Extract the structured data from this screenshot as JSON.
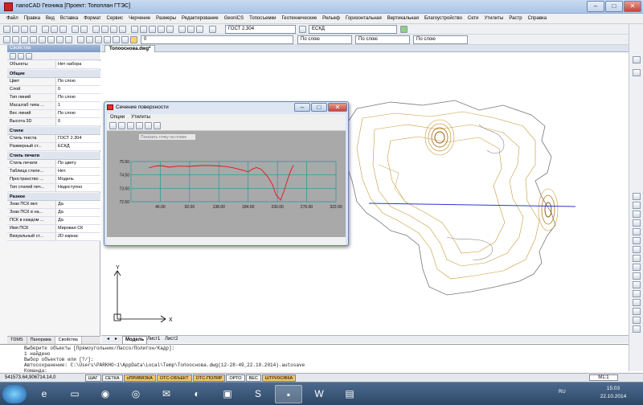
{
  "app": {
    "title": "nanoCAD Геоника [Проект: Топоплан ГТЭС]"
  },
  "window_controls": {
    "minimize": "–",
    "maximize": "□",
    "close": "✕"
  },
  "menu": [
    "Файл",
    "Правка",
    "Вид",
    "Вставка",
    "Формат",
    "Сервис",
    "Черчение",
    "Размеры",
    "Редактирование",
    "GeoniCS",
    "Топосъемки",
    "Геотехнические",
    "Рельеф",
    "Горизонтальная",
    "Вертикальная",
    "Благоустройство",
    "Сети",
    "Утилиты",
    "Растр",
    "Справка"
  ],
  "toolbar": {
    "text_style": "ГОСТ 2.304",
    "dim_style": "ЕСКД",
    "layer_value": "0",
    "linetype1": "По слою",
    "linetype2": "По слою",
    "lineweight": "По слою"
  },
  "properties": {
    "title": "Свойства",
    "objects_key": "Объекты",
    "objects_value": "Нет набора",
    "sections": {
      "general": "Общие",
      "styles": "Стили",
      "print_style": "Стиль печати",
      "misc": "Разное"
    },
    "general_rows": [
      {
        "k": "Цвет",
        "v": "По слою"
      },
      {
        "k": "Слой",
        "v": "0"
      },
      {
        "k": "Тип линий",
        "v": "По слою"
      },
      {
        "k": "Масштаб типа ...",
        "v": "1"
      },
      {
        "k": "Вес линий",
        "v": "По слою"
      },
      {
        "k": "Высота 3D",
        "v": "0"
      }
    ],
    "styles_rows": [
      {
        "k": "Стиль текста",
        "v": "ГОСТ 2.304"
      },
      {
        "k": "Размерный ст...",
        "v": "ЕСКД"
      }
    ],
    "print_rows": [
      {
        "k": "Стиль печати",
        "v": "По цвету"
      },
      {
        "k": "Таблица стиле...",
        "v": "Нет."
      },
      {
        "k": "Пространство ...",
        "v": "Модель"
      },
      {
        "k": "Тип стилей печ...",
        "v": "Недоступно"
      }
    ],
    "misc_rows": [
      {
        "k": "Знак ПСК вкл",
        "v": "Да"
      },
      {
        "k": "Знак ПСК в на...",
        "v": "Да"
      },
      {
        "k": "ПСК в каждом ...",
        "v": "Да"
      },
      {
        "k": "Имя ПСК",
        "v": "Мировая СК"
      },
      {
        "k": "Визуальный ст...",
        "v": "2D каркас"
      }
    ]
  },
  "panel_tabs": [
    "TDMS",
    "Панорама",
    "Свойства"
  ],
  "document_tab": "Топооснова.dwg*",
  "layout_tabs": [
    "Модель",
    "Лист1",
    "Лист2"
  ],
  "ucs": {
    "x_label": "X",
    "y_label": "Y"
  },
  "dialog": {
    "title": "Сечение поверхности",
    "menu": [
      "Опции",
      "Утилиты"
    ],
    "tooltip": "Показать точку на плане",
    "close": "✕"
  },
  "chart_data": {
    "type": "line",
    "title": "",
    "xlabel": "",
    "ylabel": "",
    "xlim": [
      0,
      322
    ],
    "ylim": [
      72.5,
      75.5
    ],
    "x_ticks": [
      "46.00",
      "92.00",
      "138.00",
      "184.00",
      "230.00",
      "276.00",
      "322.00"
    ],
    "y_ticks": [
      "75.50",
      "74.50",
      "73.50",
      "72.50"
    ],
    "grid": true,
    "series": [
      {
        "color": "#e8101c",
        "x": [
          28,
          35,
          46,
          60,
          75,
          92,
          110,
          125,
          138,
          150,
          160,
          170,
          178,
          184,
          190,
          197,
          205,
          215,
          222,
          228,
          235,
          240,
          245,
          250,
          255
        ],
        "y": [
          75.02,
          75.12,
          75.2,
          75.08,
          75.16,
          75.14,
          75.2,
          75.2,
          75.17,
          75.12,
          75.04,
          74.92,
          74.82,
          74.72,
          74.92,
          75.05,
          74.9,
          74.35,
          73.8,
          73.0,
          72.62,
          73.25,
          74.0,
          74.7,
          75.22
        ]
      }
    ]
  },
  "command_lines": [
    "Выберите объекты [Прямоугольник/Лассо/Полигон/Кадр]:",
    "1 найдено",
    "Выбор объектов или [?/]:",
    "Автосохранение: C:\\Users\\PARKHO~1\\AppData\\Local\\Temp\\Топооснова.dwg(12-28-49_22.10.2014).autosave",
    "Команда:"
  ],
  "status": {
    "coords": "541573.64,906714.14,0",
    "buttons": [
      {
        "label": "ШАГ",
        "on": false
      },
      {
        "label": "СЕТКА",
        "on": false
      },
      {
        "label": "оПРИВЯЗКА",
        "on": true
      },
      {
        "label": "ОТС-ОБЪЕКТ",
        "on": true
      },
      {
        "label": "ОТС-ПОЛЯР",
        "on": true
      },
      {
        "label": "ОРТО",
        "on": false
      },
      {
        "label": "ВЕС",
        "on": false
      },
      {
        "label": "ШТРИХОВКА",
        "on": true
      }
    ],
    "scale": "M1:1"
  },
  "taskbar": {
    "lang": "RU",
    "time": "15:03",
    "date": "22.10.2014"
  },
  "colors": {
    "accent": "#f7c46b",
    "contour": "#c89a3a",
    "chart_grid": "#1d9a9a",
    "section_line": "#2838d0"
  }
}
